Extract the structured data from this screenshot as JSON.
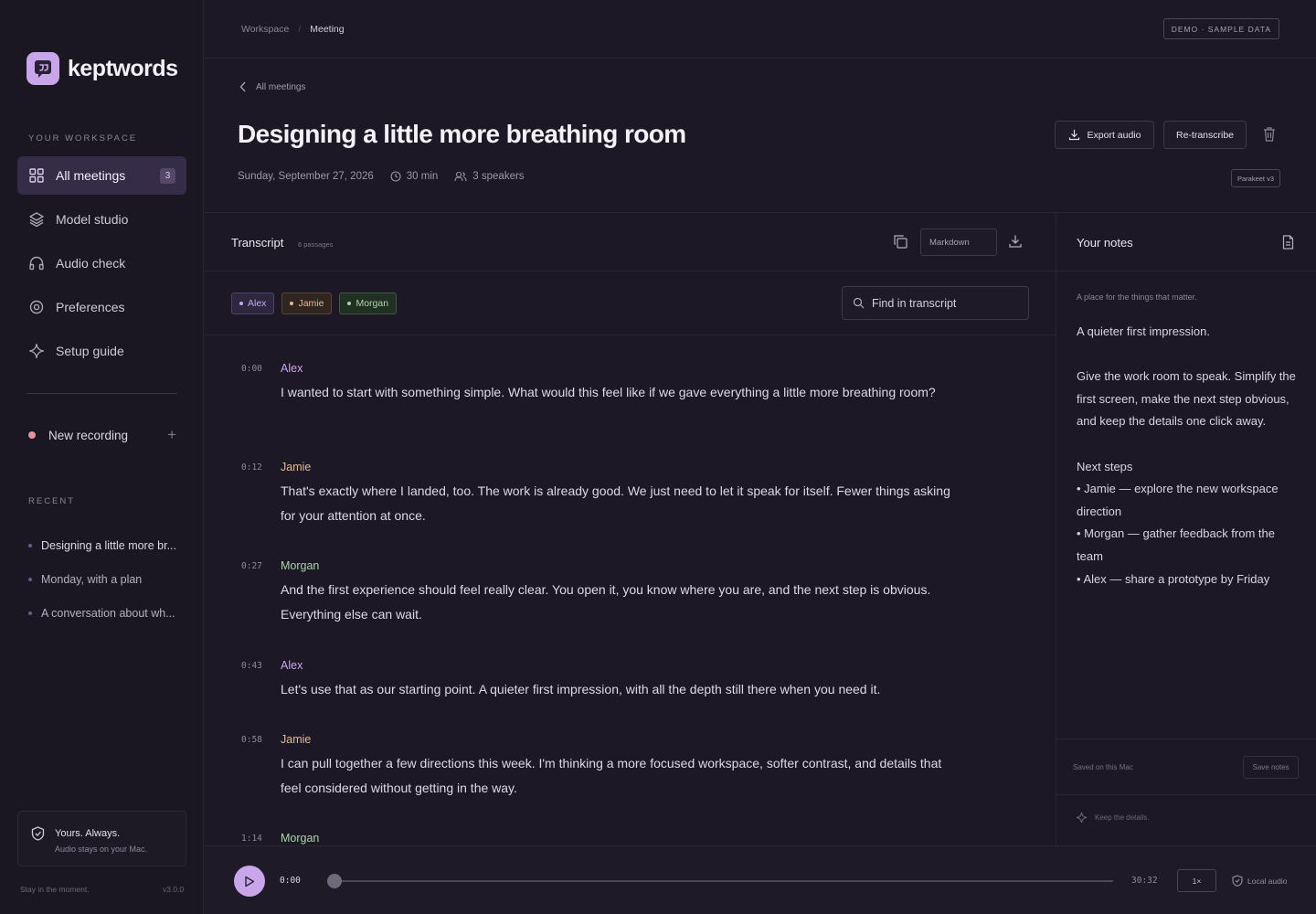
{
  "app": {
    "name": "keptwords",
    "accent": "#c9a6ea"
  },
  "sidebar": {
    "workspace_label": "YOUR WORKSPACE",
    "items": [
      {
        "label": "All meetings",
        "icon": "grid-icon",
        "badge": "3",
        "active": true
      },
      {
        "label": "Model studio",
        "icon": "layers-icon"
      },
      {
        "label": "Audio check",
        "icon": "headphones-icon"
      },
      {
        "label": "Preferences",
        "icon": "settings-icon"
      },
      {
        "label": "Setup guide",
        "icon": "sparkle-icon"
      }
    ],
    "new_recording": "New recording",
    "recent_label": "RECENT",
    "recent": [
      "Designing a little more br...",
      "Monday, with a plan",
      "A conversation about wh..."
    ],
    "privacy": {
      "title": "Yours. Always.",
      "subtitle": "Audio stays on your Mac."
    },
    "footer_left": "Stay in the moment.",
    "version": "v3.0.0"
  },
  "topbar": {
    "breadcrumb": [
      "Workspace",
      "Meeting"
    ],
    "demo_badge": "DEMO · SAMPLE DATA"
  },
  "meeting": {
    "back_label": "All meetings",
    "title": "Designing a little more breathing room",
    "date": "Sunday, September 27, 2026",
    "duration": "30 min",
    "speakers": "3 speakers",
    "export_label": "Export audio",
    "retranscribe_label": "Re-transcribe",
    "model_badge": "Parakeet v3"
  },
  "transcript": {
    "title": "Transcript",
    "passage_count": "6 passages",
    "format": "Markdown",
    "search_placeholder": "Find in transcript",
    "speakers": [
      {
        "name": "Alex",
        "color": "#c9a6ea",
        "bg": "#2e2740",
        "border": "#4f4266"
      },
      {
        "name": "Jamie",
        "color": "#e6b891",
        "bg": "#30261f",
        "border": "#5a4536"
      },
      {
        "name": "Morgan",
        "color": "#a9d4a9",
        "bg": "#223024",
        "border": "#3d5a40"
      }
    ],
    "passages": [
      {
        "time": "0:00",
        "speaker": "Alex",
        "color": "#c9a6ea",
        "text": "I wanted to start with something simple. What would this feel like if we gave everything a little more breathing room?"
      },
      {
        "time": "0:12",
        "speaker": "Jamie",
        "color": "#e6b891",
        "text": "That's exactly where I landed, too. The work is already good. We just need to let it speak for itself. Fewer things asking for your attention at once."
      },
      {
        "time": "0:27",
        "speaker": "Morgan",
        "color": "#a9d4a9",
        "text": "And the first experience should feel really clear. You open it, you know where you are, and the next step is obvious. Everything else can wait."
      },
      {
        "time": "0:43",
        "speaker": "Alex",
        "color": "#c9a6ea",
        "text": "Let's use that as our starting point. A quieter first impression, with all the depth still there when you need it."
      },
      {
        "time": "0:58",
        "speaker": "Jamie",
        "color": "#e6b891",
        "text": "I can pull together a few directions this week. I'm thinking a more focused workspace, softer contrast, and details that feel considered without getting in the way."
      },
      {
        "time": "1:14",
        "speaker": "Morgan",
        "color": "#a9d4a9",
        "text": ""
      }
    ]
  },
  "notes": {
    "title": "Your notes",
    "hint": "A place for the things that matter.",
    "line1": "A quieter first impression.",
    "para2": "Give the work room to speak. Simplify the first screen, make the next step obvious, and keep the details one click away.",
    "next_steps": "Next steps",
    "steps": [
      "• Jamie — explore the new workspace direction",
      "• Morgan — gather feedback from the team",
      "• Alex — share a prototype by Friday"
    ],
    "saved": "Saved on this Mac",
    "save_button": "Save notes",
    "keep": "Keep the details."
  },
  "player": {
    "current": "0:00",
    "total": "30:32",
    "speed": "1×",
    "local": "Local audio",
    "progress": 0
  }
}
